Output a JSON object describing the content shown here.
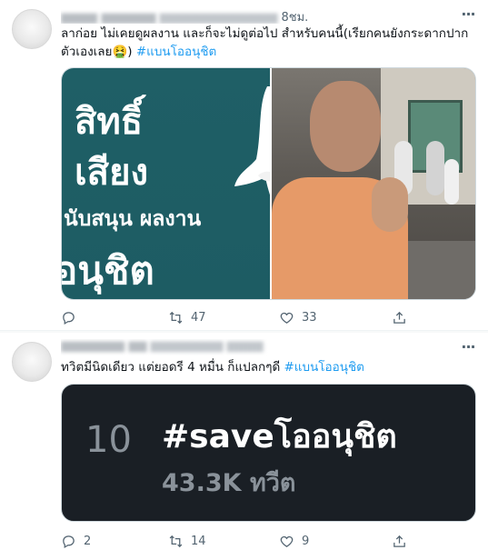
{
  "tweets": [
    {
      "time": "8ชม.",
      "text": "ลาก่อย ไม่เคยดูผลงาน และก็จะไม่ดูต่อไป สำหรับคนนี้(เรียกคนยังกระดากปากตัวเองเลย🤮) ",
      "hashtag": "#แบนโออนุชิต",
      "media_left_lines": [
        "สิทธิ์",
        "เสียง",
        "นับสนุน ผลงาน",
        "อนุชิต"
      ],
      "counts": {
        "reply": "",
        "retweet": "47",
        "like": "33"
      }
    },
    {
      "time": "",
      "text": "ทวิตมีนิดเดียว แต่ยอดรี 4 หมื่น ก็แปลกๆดี ",
      "hashtag": "#แบนโออนุชิต",
      "trend": {
        "rank": "10",
        "tag": "#saveโออนุชิต",
        "count": "43.3K ทวีต"
      },
      "counts": {
        "reply": "2",
        "retweet": "14",
        "like": "9"
      }
    }
  ],
  "icons": {
    "reply": "reply-icon",
    "retweet": "retweet-icon",
    "like": "heart-icon",
    "share": "share-icon",
    "more": "more-icon"
  },
  "colors": {
    "hashtag": "#1d9bf0",
    "icon": "#536471",
    "card_bg": "#1a1f25",
    "poster_bg": "#1f5f66"
  }
}
